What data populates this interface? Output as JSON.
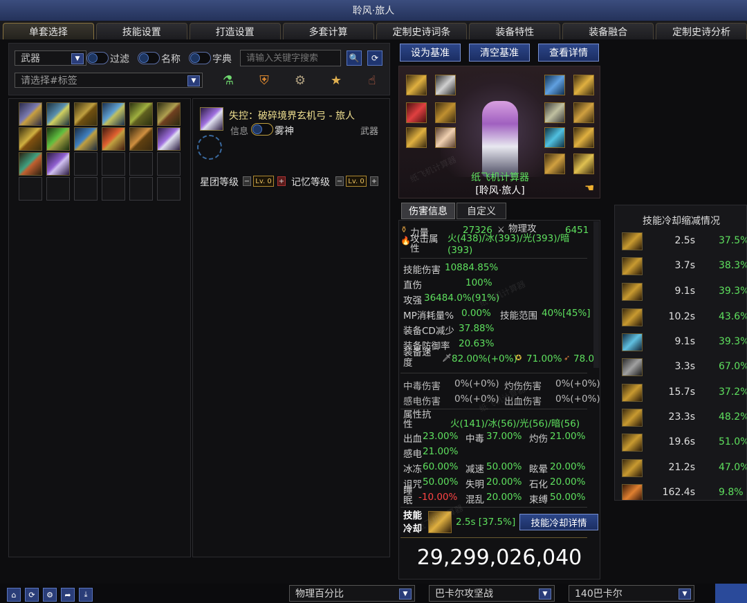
{
  "window": {
    "title": "聆风·旅人"
  },
  "tabs": [
    "单套选择",
    "技能设置",
    "打造设置",
    "多套计算",
    "定制史诗词条",
    "装备特性",
    "装备融合",
    "定制史诗分析"
  ],
  "filter": {
    "slot_select": "武器",
    "toggle_filter": "过滤",
    "toggle_name": "名称",
    "toggle_dict": "字典",
    "search_placeholder": "请输入关键字搜索",
    "tag_placeholder": "请选择#标签"
  },
  "item_detail": {
    "name": "失控：破碎境界玄机弓 - 旅人",
    "info_label": "信息",
    "tag": "雾神",
    "slot": "武器",
    "star_label": "星团等级",
    "memory_label": "记忆等级",
    "star_level": "Lv. 0",
    "memory_level": "Lv. 0"
  },
  "top_buttons": {
    "set_base": "设为基准",
    "clear_base": "清空基准",
    "view_detail": "查看详情"
  },
  "character": {
    "calc_name": "纸飞机计算器",
    "class_name": "[聆风·旅人]"
  },
  "stat_tabs": {
    "damage_info": "伤害信息",
    "custom": "自定义"
  },
  "stats": {
    "str_label": "力量",
    "str_val": "27326",
    "phys_label": "物理攻",
    "phys_val": "6451",
    "attr_label": "攻击属性",
    "attr_val": "火(438)/冰(393)/光(393)/暗(393)",
    "skill_dmg_label": "技能伤害",
    "skill_dmg_val": "10884.85%",
    "direct_label": "直伤",
    "direct_val": "100%",
    "atk_label": "攻强",
    "atk_val": "36484.0%(91%)",
    "mp_label": "MP消耗量%",
    "mp_val": "0.00%",
    "range_label": "技能范围",
    "range_val": "40%[45%]",
    "cd_label": "装备CD减少",
    "cd_val": "37.88%",
    "def_label": "装备防御率",
    "def_val": "20.63%",
    "speed_label": "装备速度",
    "speed_val1": "82.00%(+0%)",
    "speed_val2": "71.00%",
    "speed_val3": "78.0",
    "poison_label": "中毒伤害",
    "poison_val": "0%(+0%)",
    "burn_label": "灼伤伤害",
    "burn_val": "0%(+0%)",
    "shock_label": "感电伤害",
    "shock_val": "0%(+0%)",
    "bleed_label": "出血伤害",
    "bleed_val": "0%(+0%)",
    "resist_label": "属性抗性",
    "resist_val": "火(141)/冰(56)/光(56)/暗(56)",
    "r_bleed_label": "出血",
    "r_bleed_val": "23.00%",
    "r_poison_label": "中毒",
    "r_poison_val": "37.00%",
    "r_burn_label": "灼伤",
    "r_burn_val": "21.00%",
    "r_shock_label": "感电",
    "r_shock_val": "21.00%",
    "r_freeze_label": "冰冻",
    "r_freeze_val": "60.00%",
    "r_slow_label": "减速",
    "r_slow_val": "50.00%",
    "r_stun_label": "眩晕",
    "r_stun_val": "20.00%",
    "r_curse_label": "诅咒",
    "r_curse_val": "50.00%",
    "r_blind_label": "失明",
    "r_blind_val": "20.00%",
    "r_stone_label": "石化",
    "r_stone_val": "20.00%",
    "r_sleep_label": "睡眠",
    "r_sleep_val": "-10.00%",
    "r_confuse_label": "混乱",
    "r_confuse_val": "20.00%",
    "r_bind_label": "束缚",
    "r_bind_val": "50.00%",
    "skill_cd_label": "技能冷却",
    "skill_cd_val": "2.5s [37.5%]",
    "skill_cd_button": "技能冷却详情",
    "total_damage": "29,299,026,040"
  },
  "cd_panel": {
    "title": "技能冷却缩减情况",
    "rows": [
      {
        "time": "2.5s",
        "pct": "37.5%"
      },
      {
        "time": "3.7s",
        "pct": "38.3%"
      },
      {
        "time": "9.1s",
        "pct": "39.3%"
      },
      {
        "time": "10.2s",
        "pct": "43.6%"
      },
      {
        "time": "9.1s",
        "pct": "39.3%"
      },
      {
        "time": "3.3s",
        "pct": "67.0%"
      },
      {
        "time": "15.7s",
        "pct": "37.2%"
      },
      {
        "time": "23.3s",
        "pct": "48.2%"
      },
      {
        "time": "19.6s",
        "pct": "51.0%"
      },
      {
        "time": "21.2s",
        "pct": "47.0%"
      },
      {
        "time": "162.4s",
        "pct": "9.8%"
      }
    ]
  },
  "bottom": {
    "mode": "物理百分比",
    "target": "巴卡尔攻坚战",
    "target2": "140巴卡尔"
  },
  "watermark": "纸飞机计算器"
}
